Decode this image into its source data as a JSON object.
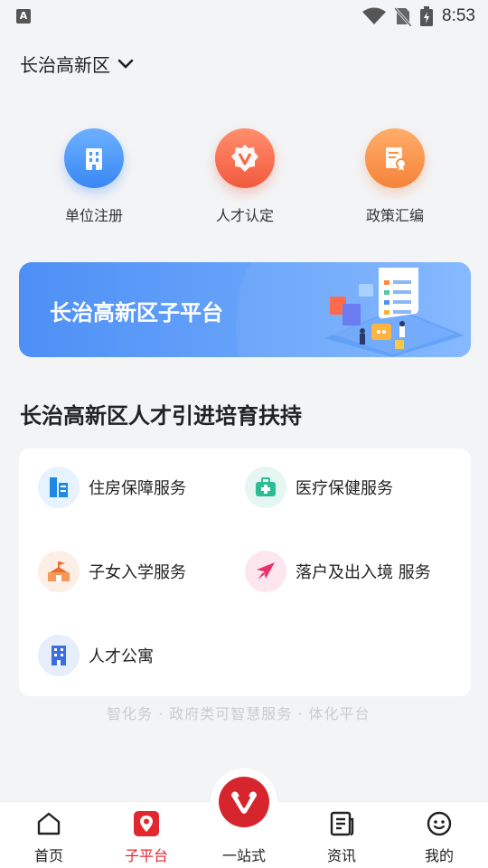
{
  "status": {
    "time": "8:53",
    "left_badge": "A"
  },
  "header": {
    "region": "长治高新区"
  },
  "quick_actions": [
    {
      "label": "单位注册"
    },
    {
      "label": "人才认定"
    },
    {
      "label": "政策汇编"
    }
  ],
  "banner": {
    "title": "长治高新区子平台"
  },
  "section": {
    "title": "长治高新区人才引进培育扶持"
  },
  "services": [
    {
      "label": "住房保障服务"
    },
    {
      "label": "医疗保健服务"
    },
    {
      "label": "子女入学服务"
    },
    {
      "label": "落户及出入境 服务"
    },
    {
      "label": "人才公寓"
    }
  ],
  "ghost_text": "智化务 · 政府类可智慧服务 · 体化平台",
  "tabs": [
    {
      "label": "首页"
    },
    {
      "label": "子平台"
    },
    {
      "label": "一站式"
    },
    {
      "label": "资讯"
    },
    {
      "label": "我的"
    }
  ],
  "colors": {
    "accent": "#e2272f",
    "banner_blue": "#4d8ff5"
  }
}
